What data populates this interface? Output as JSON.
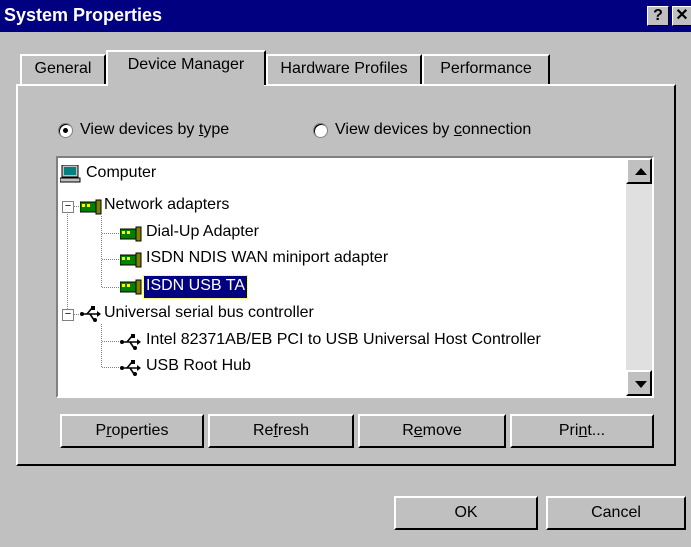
{
  "window": {
    "title": "System Properties",
    "help_glyph": "?",
    "close_glyph": "✕"
  },
  "tabs": [
    {
      "label": "General"
    },
    {
      "label": "Device Manager"
    },
    {
      "label": "Hardware Profiles"
    },
    {
      "label": "Performance"
    }
  ],
  "view_options": {
    "by_type": {
      "pre": "View devices by ",
      "key": "t",
      "post": "ype",
      "selected": true
    },
    "by_connection": {
      "pre": "View devices by ",
      "key": "c",
      "post": "onnection",
      "selected": false
    }
  },
  "tree": {
    "root": "Computer",
    "network_group": "Network adapters",
    "network_items": [
      "Dial-Up Adapter",
      "ISDN NDIS WAN miniport adapter",
      "ISDN USB TA"
    ],
    "selected_item": "ISDN USB TA",
    "usb_group": "Universal serial bus controller",
    "usb_items": [
      "Intel 82371AB/EB PCI to USB Universal Host Controller",
      "USB Root Hub"
    ],
    "expander_glyph": "−"
  },
  "buttons": {
    "properties": {
      "pre": "P",
      "key": "r",
      "post": "operties"
    },
    "refresh": {
      "pre": "Re",
      "key": "f",
      "post": "resh"
    },
    "remove": {
      "pre": "R",
      "key": "e",
      "post": "move"
    },
    "print": {
      "pre": "Pri",
      "key": "n",
      "post": "t..."
    },
    "ok": "OK",
    "cancel": "Cancel"
  },
  "colors": {
    "titlebar": "#000080",
    "face": "#c0c0c0",
    "selection": "#000080"
  }
}
